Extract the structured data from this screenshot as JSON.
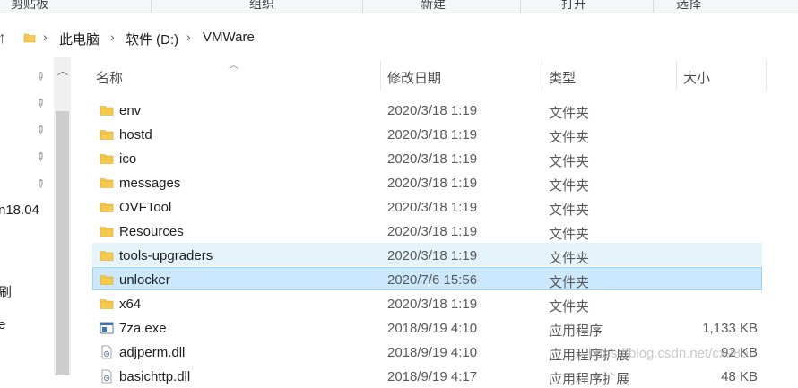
{
  "ribbon": {
    "groups": [
      "剪贴板",
      "组织",
      "新建",
      "打开",
      "选择"
    ]
  },
  "address": {
    "crumbs": [
      "此电脑",
      "软件 (D:)",
      "VMWare"
    ]
  },
  "nav": {
    "items": [
      "n18.04",
      "刷",
      "e"
    ]
  },
  "columns": {
    "name": "名称",
    "date": "修改日期",
    "type": "类型",
    "size": "大小"
  },
  "files": [
    {
      "name": "env",
      "date": "2020/3/18 1:19",
      "type": "文件夹",
      "size": "",
      "icon": "folder-icon"
    },
    {
      "name": "hostd",
      "date": "2020/3/18 1:19",
      "type": "文件夹",
      "size": "",
      "icon": "folder-icon"
    },
    {
      "name": "ico",
      "date": "2020/3/18 1:19",
      "type": "文件夹",
      "size": "",
      "icon": "folder-icon"
    },
    {
      "name": "messages",
      "date": "2020/3/18 1:19",
      "type": "文件夹",
      "size": "",
      "icon": "folder-icon"
    },
    {
      "name": "OVFTool",
      "date": "2020/3/18 1:19",
      "type": "文件夹",
      "size": "",
      "icon": "folder-icon"
    },
    {
      "name": "Resources",
      "date": "2020/3/18 1:19",
      "type": "文件夹",
      "size": "",
      "icon": "folder-icon"
    },
    {
      "name": "tools-upgraders",
      "date": "2020/3/18 1:19",
      "type": "文件夹",
      "size": "",
      "icon": "folder-icon"
    },
    {
      "name": "unlocker",
      "date": "2020/7/6 15:56",
      "type": "文件夹",
      "size": "",
      "icon": "folder-icon"
    },
    {
      "name": "x64",
      "date": "2020/3/18 1:19",
      "type": "文件夹",
      "size": "",
      "icon": "folder-icon"
    },
    {
      "name": "7za.exe",
      "date": "2018/9/19 4:10",
      "type": "应用程序",
      "size": "1,133 KB",
      "icon": "exe-icon"
    },
    {
      "name": "adjperm.dll",
      "date": "2018/9/19 4:10",
      "type": "应用程序扩展",
      "size": "92 KB",
      "icon": "dll-icon"
    },
    {
      "name": "basichttp.dll",
      "date": "2018/9/19 4:17",
      "type": "应用程序扩展",
      "size": "48 KB",
      "icon": "dll-icon"
    }
  ],
  "watermark": "https://blog.csdn.net/cx980",
  "colors": {
    "folder": "#f8c94a",
    "hover": "#e5f3fb",
    "selected": "#cce8ff",
    "selected_border": "#99d1ff"
  }
}
